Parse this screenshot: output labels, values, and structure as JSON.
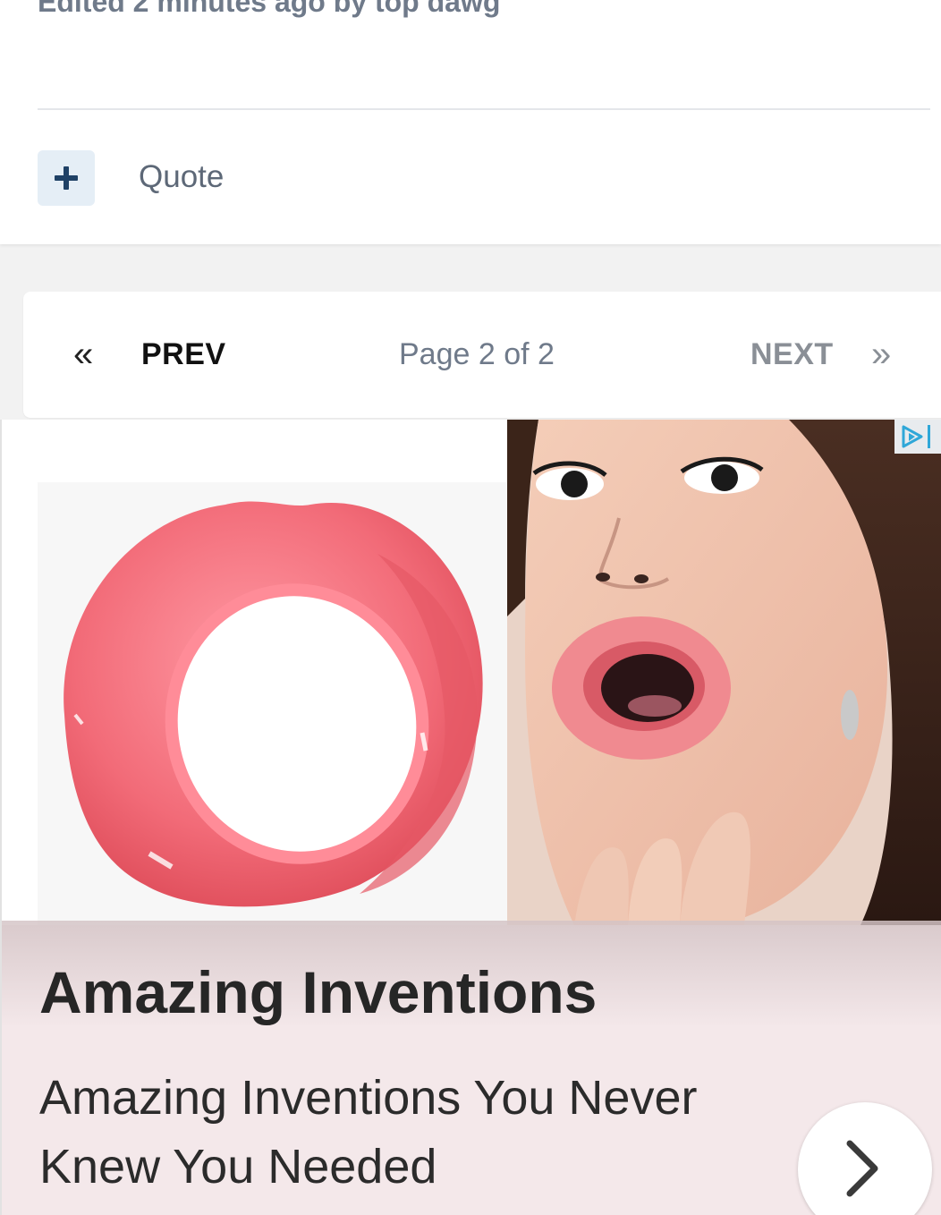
{
  "post": {
    "edited_note": "Edited 2 minutes ago by top dawg",
    "quote_label": "Quote"
  },
  "pagination": {
    "prev_arrow": "«",
    "prev_label": "PREV",
    "page_indicator": "Page 2 of 2",
    "next_label": "NEXT",
    "next_arrow": "»"
  },
  "ad": {
    "headline": "Amazing Inventions",
    "description": "Amazing Inventions You Never Knew You Needed",
    "image_icon": "product-photo",
    "choices_icon": "ad-choices-icon",
    "next_icon": "chevron-right-icon"
  },
  "colors": {
    "accent_dark_blue": "#1f4166",
    "plus_button_bg": "#e5eef6",
    "muted_text": "#6f7a8a",
    "ad_background": "#f4e8ea"
  }
}
